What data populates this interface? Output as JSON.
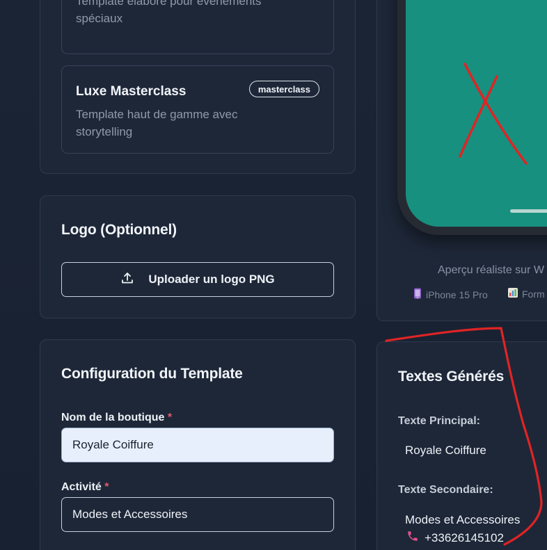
{
  "templates": [
    {
      "title": "",
      "description": "Template élaboré pour événements spéciaux",
      "tag": ""
    },
    {
      "title": "Luxe Masterclass",
      "description": "Template haut de gamme avec storytelling",
      "tag": "masterclass"
    }
  ],
  "logo": {
    "title": "Logo (Optionnel)",
    "upload_label": "Uploader un logo PNG",
    "icon": "upload-icon"
  },
  "config": {
    "title": "Configuration du Template",
    "shop_name_label": "Nom de la boutique",
    "activity_label": "Activité",
    "required_mark": "*",
    "shop_name_value": "Royale Coiffure",
    "activity_value": "Modes et Accessoires"
  },
  "preview": {
    "caption": "Aperçu réaliste sur W",
    "device": "iPhone 15 Pro",
    "format": "Form",
    "device_icon": "phone-icon",
    "format_icon": "chart-icon",
    "screen_color": "#17907f"
  },
  "texts": {
    "title": "Textes Générés",
    "primary_label": "Texte Principal:",
    "primary_value": "Royale Coiffure",
    "secondary_label": "Texte Secondaire:",
    "secondary_value": "Modes et Accessoires",
    "phone": "+33626145102",
    "phone_icon": "phone-icon"
  },
  "colors": {
    "background": "#182132",
    "card": "#1e2738",
    "annotation_red": "#e02424",
    "accent_pink": "#e0518c"
  }
}
